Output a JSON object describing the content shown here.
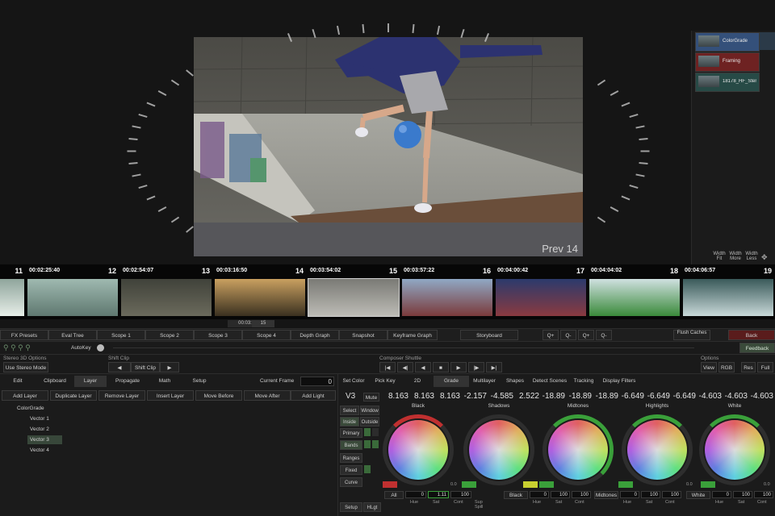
{
  "viewer": {
    "overlay": "Prev 14"
  },
  "layers_panel": {
    "nodes": [
      {
        "label": "ColorGrade",
        "color": "#34507a"
      },
      {
        "label": "Framing",
        "color": "#6e2222"
      },
      {
        "label": "18178_HF_Stereo Panels_2014_N",
        "color": "#274a46"
      }
    ],
    "mini_buttons": [
      "Width Fit",
      "Width More",
      "Width Less"
    ]
  },
  "filmstrip": {
    "frames": [
      {
        "num": "11",
        "tc": "",
        "colors": [
          "#8fa59c",
          "#e7eee8"
        ]
      },
      {
        "num": "12",
        "tc": "00:02:25:40",
        "colors": [
          "#9fb9b0",
          "#5f7870"
        ]
      },
      {
        "num": "13",
        "tc": "00:02:54:07",
        "colors": [
          "#40423a",
          "#6b6a5c"
        ]
      },
      {
        "num": "14",
        "tc": "00:03:16:50",
        "colors": [
          "#c9a060",
          "#3a3020"
        ]
      },
      {
        "num": "15",
        "tc": "00:03:54:02",
        "colors": [
          "#7a7a75",
          "#bdbcb6"
        ]
      },
      {
        "num": "16",
        "tc": "00:03:57:22",
        "colors": [
          "#90a8c4",
          "#7a3a3a"
        ]
      },
      {
        "num": "17",
        "tc": "00:04:00:42",
        "colors": [
          "#2c3a6c",
          "#8a3a40"
        ]
      },
      {
        "num": "18",
        "tc": "00:04:04:02",
        "colors": [
          "#cfe0e0",
          "#3a8a3a"
        ]
      },
      {
        "num": "19",
        "tc": "00:04:06:57",
        "colors": [
          "#3a5a5a",
          "#c8d8d8"
        ]
      }
    ],
    "scrub_tc": "00:03:54:02",
    "scrub_num": "15"
  },
  "toolbar1": {
    "buttons": [
      "FX Presets",
      "Eval Tree",
      "Scope 1",
      "Scope 2",
      "Scope 3",
      "Scope 4",
      "Depth Graph",
      "Snapshot",
      "Keyframe Graph",
      "Storyboard"
    ],
    "zoom": [
      "Q+",
      "Q-",
      "Q+",
      "Q-"
    ],
    "flush": "Flush Caches",
    "back": "Back",
    "autokey": "AutoKey",
    "feedback": "Feedback"
  },
  "toolbar2": {
    "stereo_label": "Stereo 3D Options",
    "stereo_mode": "Use Stereo Mode",
    "shift_label": "Shift Clip",
    "shift_btn": "Shift Clip",
    "composer_label": "Composer Shuttle",
    "options_label": "Options",
    "view": "View",
    "rgb": "RGB",
    "res": "Res",
    "full": "Full"
  },
  "left_tabs": [
    "Edit",
    "Clipboard",
    "Layer",
    "Propagate",
    "Math",
    "Setup"
  ],
  "current_frame": {
    "label": "Current Frame",
    "value": "0"
  },
  "layer_buttons": [
    "Add Layer",
    "Duplicate Layer",
    "Remove Layer",
    "Insert Layer",
    "Move Before",
    "Move After",
    "Add Light"
  ],
  "tree": [
    "ColorGrade",
    "Vector 1",
    "Vector 2",
    "Vector 3",
    "Vector 4"
  ],
  "right_tabs": [
    "Set Color",
    "Pick Key",
    "2D",
    "Grade",
    "Multilayer",
    "Shapes",
    "Detect Scenes",
    "Tracking",
    "Display Filters"
  ],
  "grade": {
    "version": "V3",
    "mute": "Mute",
    "values": [
      "8.163",
      "8.163",
      "8.163",
      "-2.157",
      "-4.585",
      "2.522",
      "-18.89",
      "-18.89",
      "-18.89",
      "-6.649",
      "-6.649",
      "-6.649",
      "-4.603",
      "-4.603",
      "-4.603"
    ],
    "side_buttons": [
      "Select",
      "Window",
      "Inside",
      "Outside",
      "Primary",
      "Bands",
      "Ranges",
      "Fixed",
      "Curve",
      "Setup",
      "HLgt"
    ],
    "wheels": [
      "Black",
      "Shadows",
      "Midtones",
      "Highlights",
      "White"
    ],
    "footer": {
      "all": "All",
      "all_fields": [
        "0",
        "1.11",
        "100"
      ],
      "black": "Black",
      "black_fields": [
        "0",
        "100",
        "100"
      ],
      "midtones": "Midtones",
      "midtones_fields": [
        "0",
        "100",
        "100"
      ],
      "white": "White",
      "white_fields": [
        "0",
        "100",
        "100"
      ],
      "sub_labels": [
        "Hue",
        "Sat",
        "Cont",
        "Sup Spill"
      ],
      "zero": "0.0"
    }
  }
}
